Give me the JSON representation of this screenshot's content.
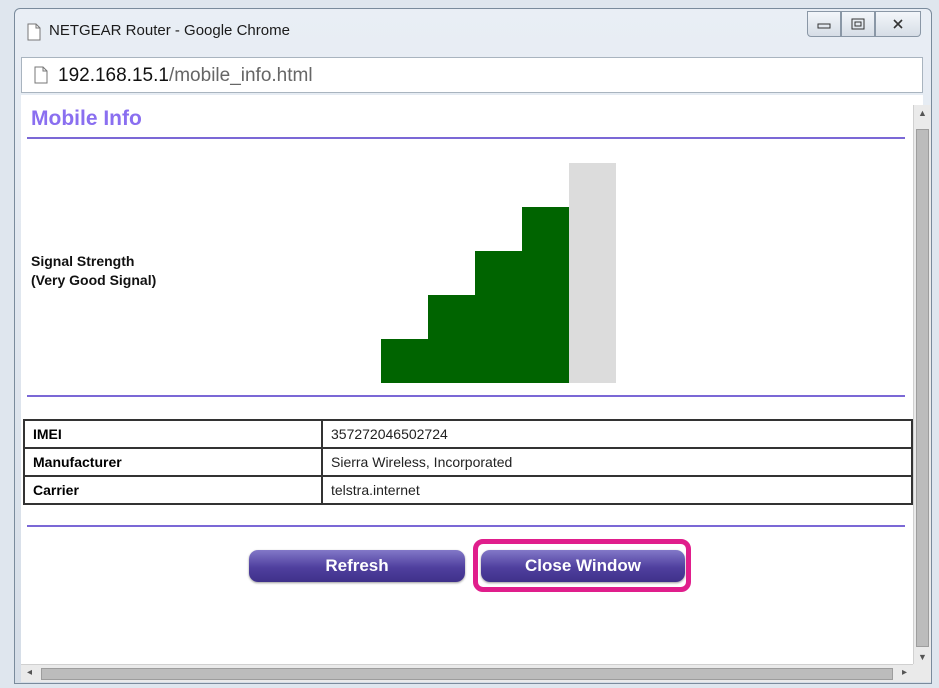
{
  "window": {
    "title": "NETGEAR Router - Google Chrome"
  },
  "address": {
    "host": "192.168.15.1",
    "path": "/mobile_info.html"
  },
  "page": {
    "title": "Mobile Info"
  },
  "signal": {
    "label_line1": "Signal Strength",
    "label_line2": "(Very Good Signal)",
    "bars_total": 5,
    "bars_filled": 4,
    "filled_color": "#006400",
    "empty_color": "#dcdcdc"
  },
  "info": {
    "rows": [
      {
        "label": "IMEI",
        "value": "357272046502724"
      },
      {
        "label": "Manufacturer",
        "value": "Sierra Wireless, Incorporated"
      },
      {
        "label": "Carrier",
        "value": "telstra.internet"
      }
    ]
  },
  "buttons": {
    "refresh": "Refresh",
    "close": "Close Window"
  },
  "colors": {
    "accent": "#8a6ff0",
    "rule": "#7b68d6",
    "highlight": "#e01e8c"
  }
}
